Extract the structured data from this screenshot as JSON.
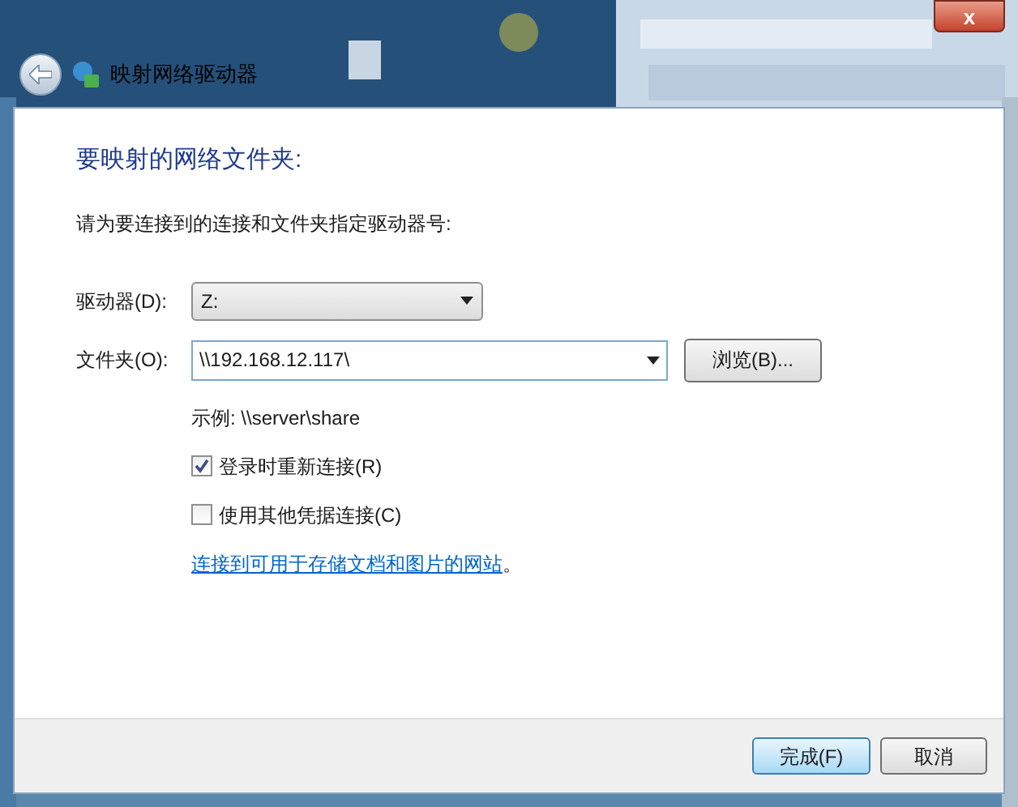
{
  "window": {
    "title": "映射网络驱动器",
    "close": "x"
  },
  "heading": "要映射的网络文件夹:",
  "description": "请为要连接到的连接和文件夹指定驱动器号:",
  "drive": {
    "label": "驱动器(D):",
    "value": "Z:"
  },
  "folder": {
    "label": "文件夹(O):",
    "value": "\\\\192.168.12.117\\",
    "browse": "浏览(B)..."
  },
  "example": "示例: \\\\server\\share",
  "options": [
    {
      "label": "登录时重新连接(R)",
      "checked": true
    },
    {
      "label": "使用其他凭据连接(C)",
      "checked": false
    }
  ],
  "link": {
    "text": "连接到可用于存储文档和图片的网站",
    "tail": "。"
  },
  "buttons": [
    {
      "label": "完成(F)",
      "kind": "default"
    },
    {
      "label": "取消",
      "kind": "normal"
    }
  ]
}
